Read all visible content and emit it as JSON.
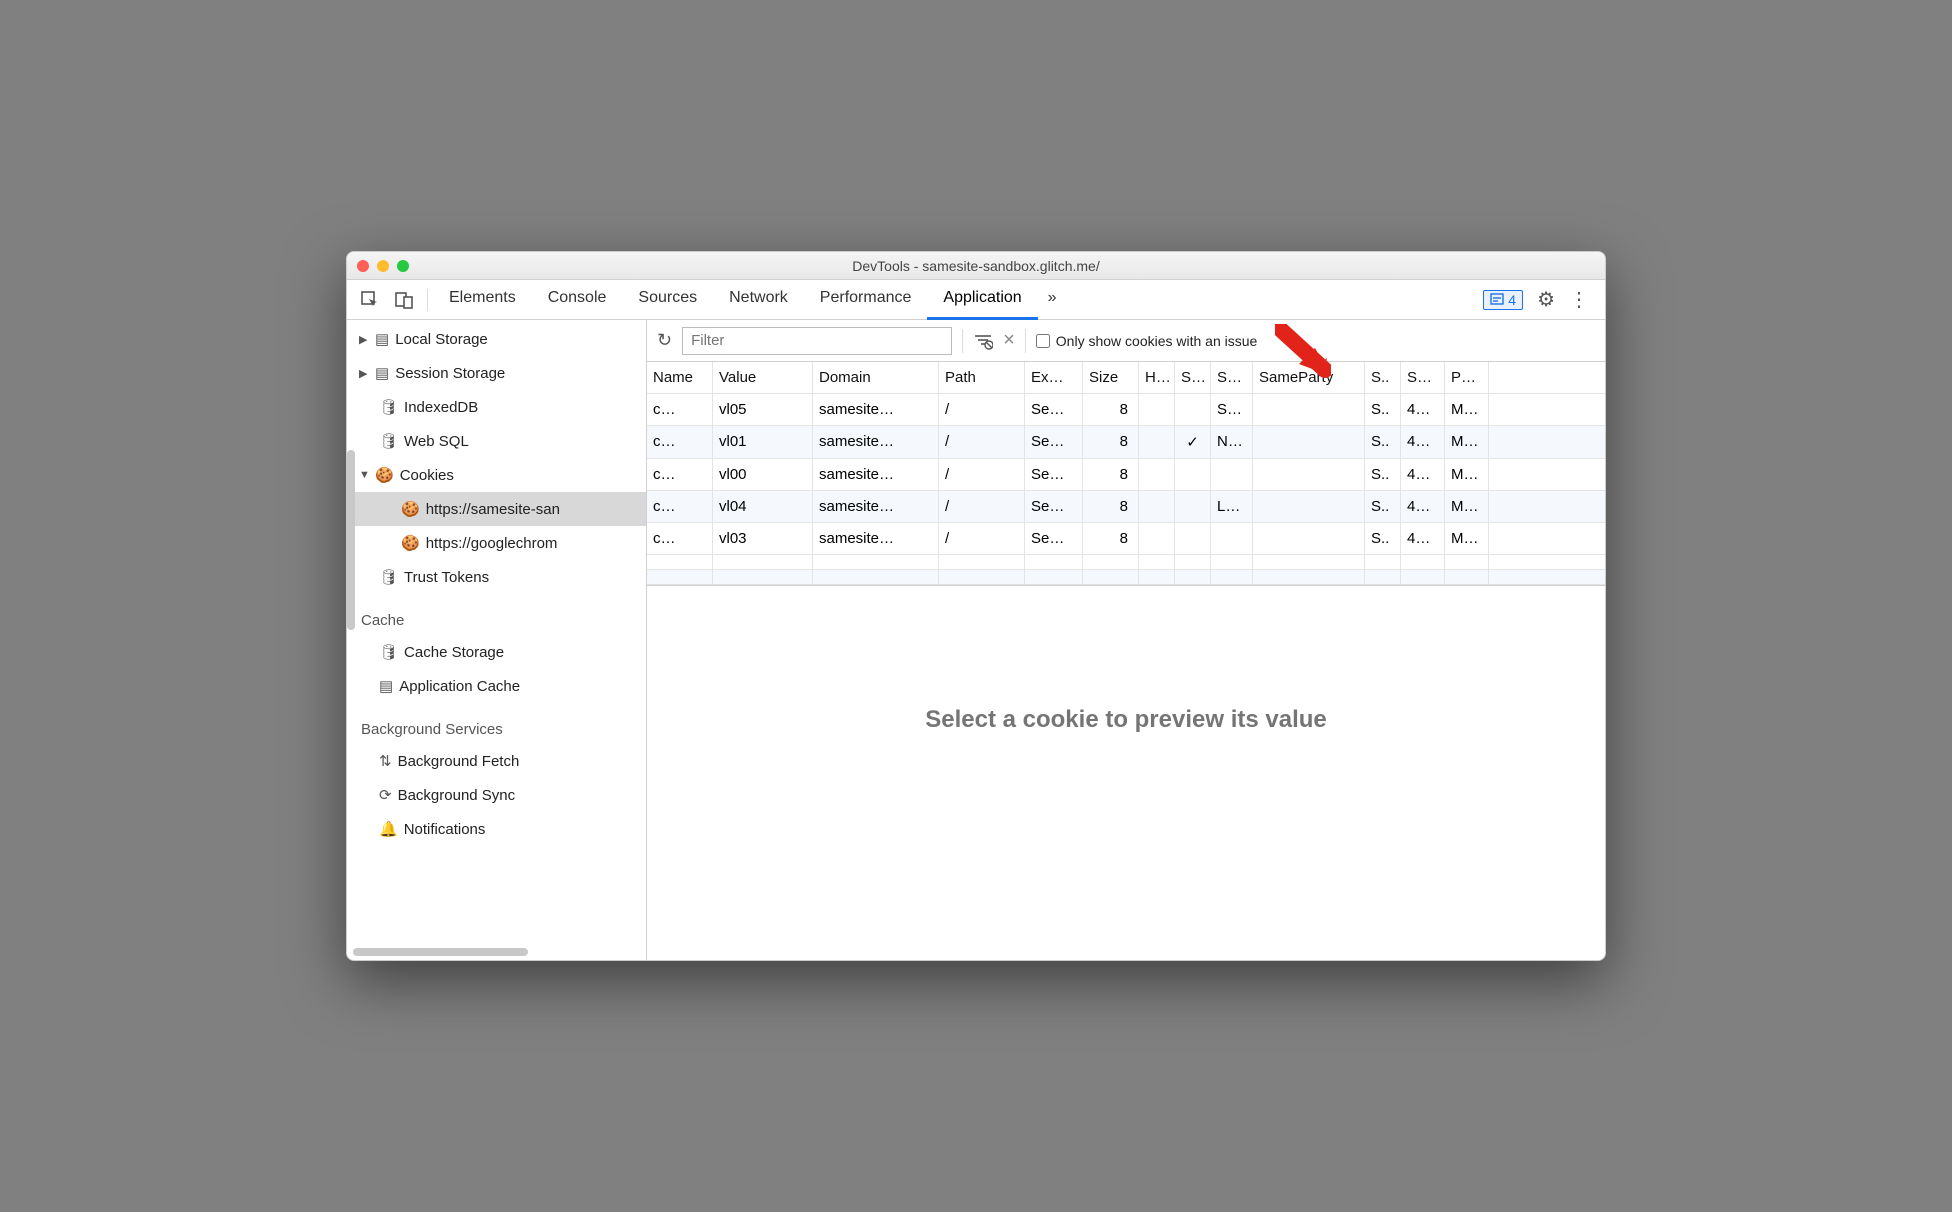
{
  "window": {
    "title": "DevTools - samesite-sandbox.glitch.me/"
  },
  "tabs": {
    "items": [
      "Elements",
      "Console",
      "Sources",
      "Network",
      "Performance",
      "Application"
    ],
    "active": "Application",
    "overflow": "»",
    "issues_count": "4"
  },
  "sidebar": {
    "storage": {
      "local": "Local Storage",
      "session": "Session Storage",
      "indexed": "IndexedDB",
      "websql": "Web SQL",
      "cookies": "Cookies",
      "cookie_origins": [
        "https://samesite-san",
        "https://googlechrom"
      ],
      "trust": "Trust Tokens"
    },
    "cache": {
      "header": "Cache",
      "storage": "Cache Storage",
      "app": "Application Cache"
    },
    "bg": {
      "header": "Background Services",
      "fetch": "Background Fetch",
      "sync": "Background Sync",
      "notif": "Notifications"
    }
  },
  "toolbar": {
    "filter_placeholder": "Filter",
    "only_issues_label": "Only show cookies with an issue"
  },
  "columns": [
    "Name",
    "Value",
    "Domain",
    "Path",
    "Ex…",
    "Size",
    "H…",
    "S…",
    "S…",
    "SameParty",
    "S..",
    "S…",
    "P…"
  ],
  "rows": [
    {
      "name": "c…",
      "value": "vl05",
      "domain": "samesite…",
      "path": "/",
      "exp": "Se…",
      "size": "8",
      "http": "",
      "sec": "",
      "ss": "S…",
      "sp": "",
      "s1": "S..",
      "s2": "4…",
      "pr": "M…"
    },
    {
      "name": "c…",
      "value": "vl01",
      "domain": "samesite…",
      "path": "/",
      "exp": "Se…",
      "size": "8",
      "http": "",
      "sec": "✓",
      "ss": "N…",
      "sp": "",
      "s1": "S..",
      "s2": "4…",
      "pr": "M…"
    },
    {
      "name": "c…",
      "value": "vl00",
      "domain": "samesite…",
      "path": "/",
      "exp": "Se…",
      "size": "8",
      "http": "",
      "sec": "",
      "ss": "",
      "sp": "",
      "s1": "S..",
      "s2": "4…",
      "pr": "M…"
    },
    {
      "name": "c…",
      "value": "vl04",
      "domain": "samesite…",
      "path": "/",
      "exp": "Se…",
      "size": "8",
      "http": "",
      "sec": "",
      "ss": "L…",
      "sp": "",
      "s1": "S..",
      "s2": "4…",
      "pr": "M…"
    },
    {
      "name": "c…",
      "value": "vl03",
      "domain": "samesite…",
      "path": "/",
      "exp": "Se…",
      "size": "8",
      "http": "",
      "sec": "",
      "ss": "",
      "sp": "",
      "s1": "S..",
      "s2": "4…",
      "pr": "M…"
    }
  ],
  "preview": {
    "message": "Select a cookie to preview its value"
  }
}
